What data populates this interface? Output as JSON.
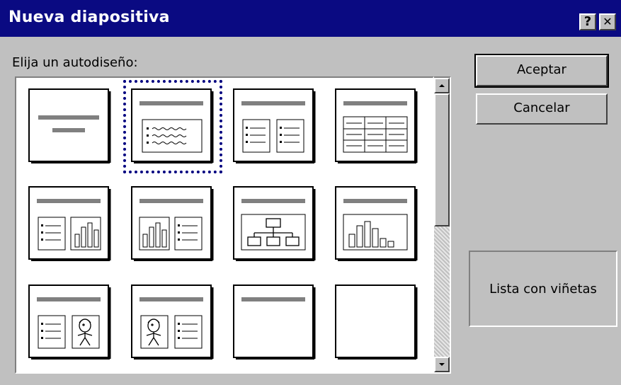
{
  "dialog": {
    "title": "Nueva diapositiva",
    "help_button": "?",
    "close_button": "✕",
    "prompt": "Elija un autodiseño:"
  },
  "buttons": {
    "ok": "Aceptar",
    "cancel": "Cancelar"
  },
  "preview": {
    "selected_layout_name": "Lista con viñetas"
  },
  "layouts": [
    {
      "name": "title-slide",
      "selected": false
    },
    {
      "name": "bulleted-list",
      "selected": true
    },
    {
      "name": "two-column-text",
      "selected": false
    },
    {
      "name": "table",
      "selected": false
    },
    {
      "name": "text-and-chart",
      "selected": false
    },
    {
      "name": "chart-and-text",
      "selected": false
    },
    {
      "name": "organization-chart",
      "selected": false
    },
    {
      "name": "chart",
      "selected": false
    },
    {
      "name": "text-and-clip-art",
      "selected": false
    },
    {
      "name": "clip-art-and-text",
      "selected": false
    },
    {
      "name": "title-only",
      "selected": false
    },
    {
      "name": "blank",
      "selected": false
    }
  ],
  "scrollbar": {
    "up_icon": "up-arrow",
    "down_icon": "down-arrow"
  },
  "colors": {
    "titlebar": "#0a0a82",
    "dialog_bg": "#c0c0c0",
    "selection": "#000080"
  }
}
